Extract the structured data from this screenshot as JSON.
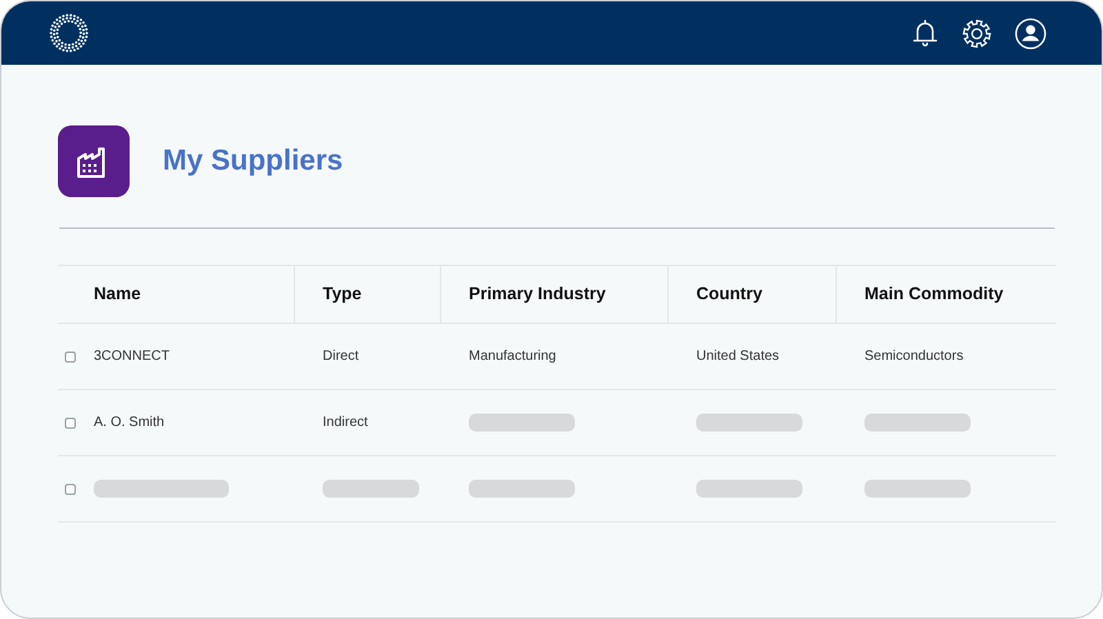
{
  "page": {
    "title": "My Suppliers"
  },
  "table": {
    "columns": [
      "Name",
      "Type",
      "Primary Industry",
      "Country",
      "Main Commodity"
    ],
    "rows": [
      {
        "checked": false,
        "cells": [
          {
            "kind": "text",
            "text": "3CONNECT"
          },
          {
            "kind": "text",
            "text": "Direct"
          },
          {
            "kind": "text",
            "text": "Manufacturing"
          },
          {
            "kind": "text",
            "text": "United States"
          },
          {
            "kind": "text",
            "text": "Semiconductors"
          }
        ]
      },
      {
        "checked": false,
        "cells": [
          {
            "kind": "text",
            "text": "A. O. Smith"
          },
          {
            "kind": "text",
            "text": "Indirect"
          },
          {
            "kind": "placeholder"
          },
          {
            "kind": "placeholder"
          },
          {
            "kind": "placeholder"
          }
        ]
      },
      {
        "checked": false,
        "cells": [
          {
            "kind": "placeholder"
          },
          {
            "kind": "placeholder"
          },
          {
            "kind": "placeholder"
          },
          {
            "kind": "placeholder"
          },
          {
            "kind": "placeholder"
          }
        ]
      }
    ]
  }
}
